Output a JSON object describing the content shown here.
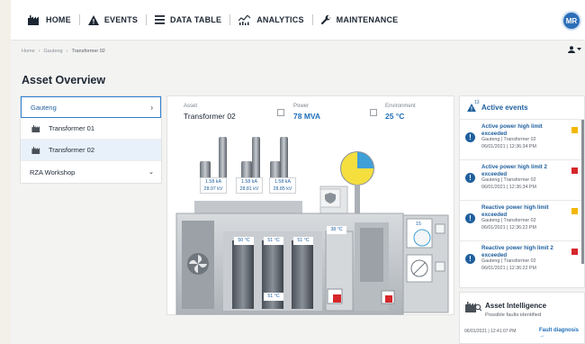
{
  "nav": {
    "home": "HOME",
    "events": "EVENTS",
    "data_table": "DATA TABLE",
    "analytics": "ANALYTICS",
    "maintenance": "MAINTENANCE",
    "avatar": "MR"
  },
  "breadcrumb": [
    "Home",
    "Gauteng",
    "Transformer 02"
  ],
  "page_title": "Asset Overview",
  "tree": {
    "region": "Gauteng",
    "children": [
      "Transformer 01",
      "Transformer 02"
    ],
    "selected": "Transformer 02",
    "workshop": "RZA Workshop"
  },
  "asset": {
    "asset_label": "Asset",
    "asset_value": "Transformer 02",
    "power_label": "Power",
    "power_value": "78 MVA",
    "env_label": "Environment",
    "env_value": "25 °C"
  },
  "bushings": [
    {
      "current": "1.58 kA",
      "voltage": "28.97 kV"
    },
    {
      "current": "1.58 kA",
      "voltage": "28.81 kV"
    },
    {
      "current": "1.58 kA",
      "voltage": "28.85 kV"
    }
  ],
  "temps": {
    "t1": "50 °C",
    "t2": "51 °C",
    "t3": "51 °C",
    "t4": "38 °C",
    "t5": "51 °C",
    "tap": "15"
  },
  "events": {
    "title": "Active events",
    "count": "13",
    "items": [
      {
        "title": "Active power high limit exceeded",
        "location": "Gauteng | Transformer 02",
        "time": "06/01/2021 | 12:36:34 PM",
        "severity_color": "#f2b705"
      },
      {
        "title": "Active power high limit 2 exceeded",
        "location": "Gauteng | Transformer 02",
        "time": "06/01/2021 | 12:36:34 PM",
        "severity_color": "#d6262b"
      },
      {
        "title": "Reactive power high limit exceeded",
        "location": "Gauteng | Transformer 02",
        "time": "06/01/2021 | 12:36:22 PM",
        "severity_color": "#f2b705"
      },
      {
        "title": "Reactive power high limit 2 exceeded",
        "location": "Gauteng | Transformer 02",
        "time": "06/01/2021 | 12:36:22 PM",
        "severity_color": "#d6262b"
      }
    ]
  },
  "intelligence": {
    "title": "Asset Intelligence",
    "subtitle": "Possible faults identified",
    "time": "06/01/2021 | 12:41:07 PM",
    "link": "Fault diagnosis →"
  },
  "colors": {
    "accent": "#1f5f9e",
    "link": "#1f6fb8",
    "alarm_red": "#d6262b",
    "warn_yellow": "#f2b705"
  }
}
